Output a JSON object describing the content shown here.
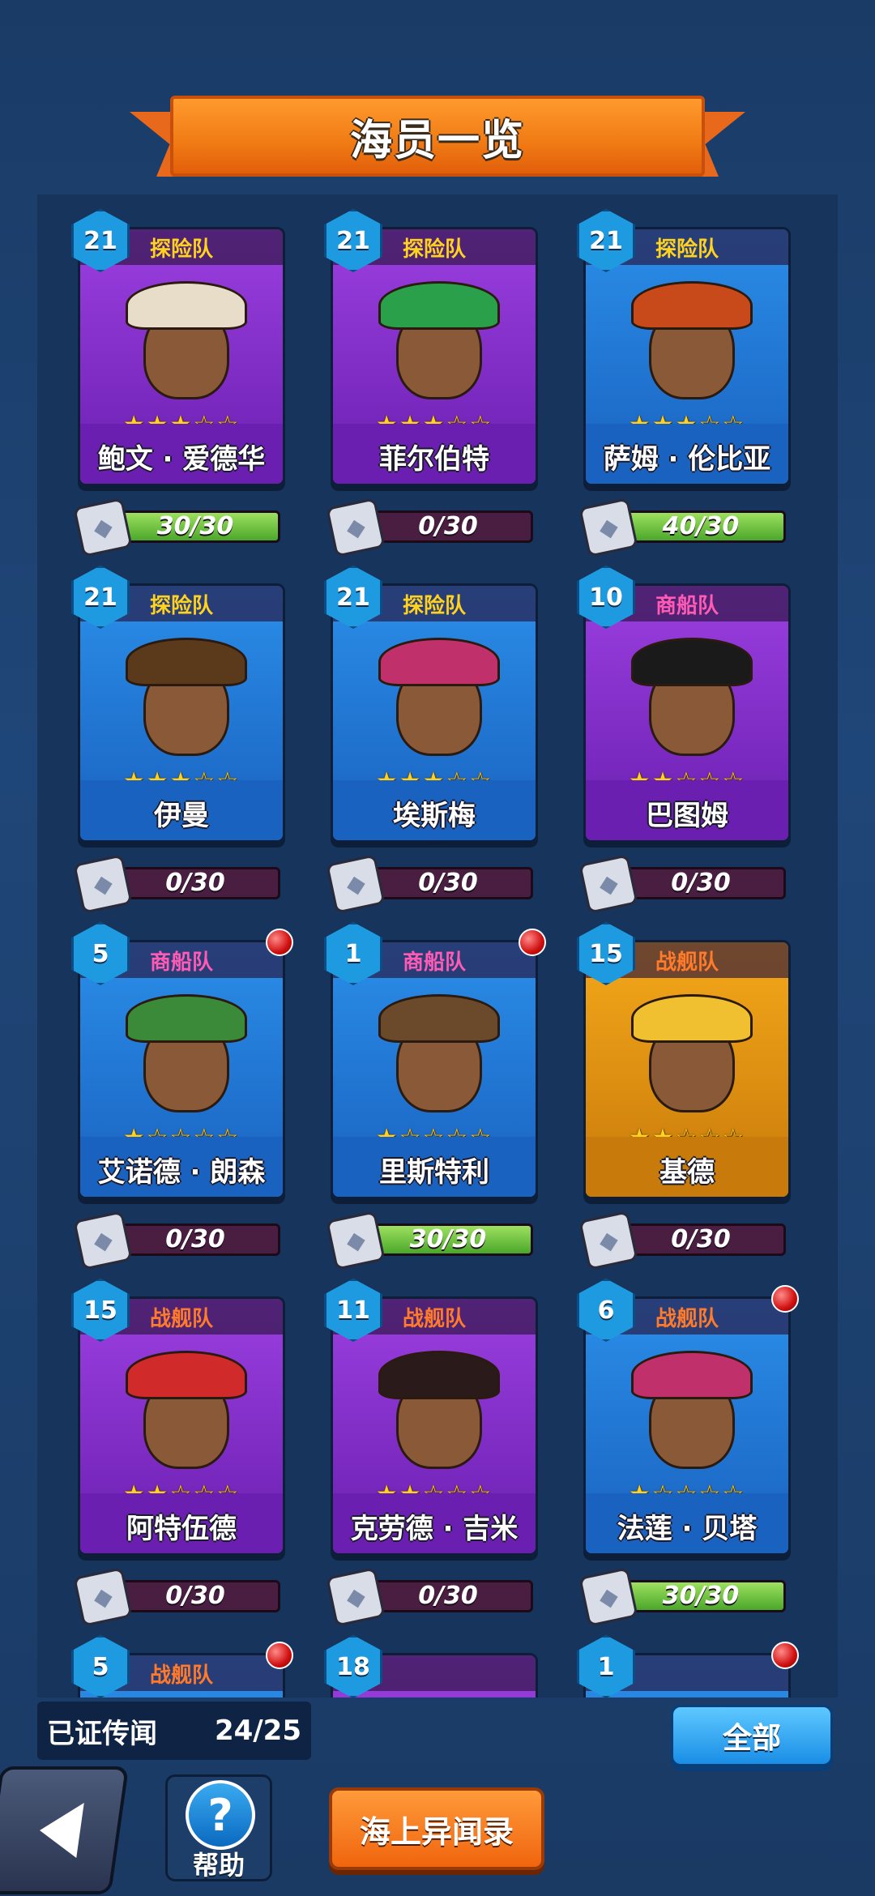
{
  "header": {
    "title": "海员一览"
  },
  "crew": [
    {
      "level": "21",
      "team": "探险队",
      "team_color": "#ffd21f",
      "name": "鲍文 · 爱德华",
      "stars": "★★★☆☆",
      "card_color": "#9b3fe0",
      "frame_color": "#6a1fb0",
      "progress": "30/30",
      "progress_value": 1.0,
      "new_badge": false,
      "hat_color": "#e8ddc8"
    },
    {
      "level": "21",
      "team": "探险队",
      "team_color": "#ffd21f",
      "name": "菲尔伯特",
      "stars": "★★★☆☆",
      "card_color": "#9b3fe0",
      "frame_color": "#6a1fb0",
      "progress": "0/30",
      "progress_value": 0.0,
      "new_badge": false,
      "hat_color": "#2aa04a"
    },
    {
      "level": "21",
      "team": "探险队",
      "team_color": "#ffd21f",
      "name": "萨姆 · 伦比亚",
      "stars": "★★★☆☆",
      "card_color": "#2a8ee8",
      "frame_color": "#1a62c0",
      "progress": "40/30",
      "progress_value": 1.0,
      "new_badge": false,
      "hat_color": "#c84a1a"
    },
    {
      "level": "21",
      "team": "探险队",
      "team_color": "#ffd21f",
      "name": "伊曼",
      "stars": "★★★☆☆",
      "card_color": "#2a8ee8",
      "frame_color": "#1a62c0",
      "progress": "0/30",
      "progress_value": 0.0,
      "new_badge": false,
      "hat_color": "#5a3a1a"
    },
    {
      "level": "21",
      "team": "探险队",
      "team_color": "#ffd21f",
      "name": "埃斯梅",
      "stars": "★★★☆☆",
      "card_color": "#2a8ee8",
      "frame_color": "#1a62c0",
      "progress": "0/30",
      "progress_value": 0.0,
      "new_badge": false,
      "hat_color": "#c0306a"
    },
    {
      "level": "10",
      "team": "商船队",
      "team_color": "#ff5ab4",
      "name": "巴图姆",
      "stars": "★★☆☆☆",
      "card_color": "#9b3fe0",
      "frame_color": "#6a1fb0",
      "progress": "0/30",
      "progress_value": 0.0,
      "new_badge": false,
      "hat_color": "#1a1a1a"
    },
    {
      "level": "5",
      "team": "商船队",
      "team_color": "#ff5ab4",
      "name": "艾诺德 · 朗森",
      "stars": "★☆☆☆☆",
      "card_color": "#2a8ee8",
      "frame_color": "#1a62c0",
      "progress": "0/30",
      "progress_value": 0.0,
      "new_badge": true,
      "hat_color": "#3a8a3a"
    },
    {
      "level": "1",
      "team": "商船队",
      "team_color": "#ff5ab4",
      "name": "里斯特利",
      "stars": "★☆☆☆☆",
      "card_color": "#2a8ee8",
      "frame_color": "#1a62c0",
      "progress": "30/30",
      "progress_value": 1.0,
      "new_badge": true,
      "hat_color": "#6a4a2a"
    },
    {
      "level": "15",
      "team": "战舰队",
      "team_color": "#ff7a2a",
      "name": "基德",
      "stars": "★★☆☆☆",
      "card_color": "#f4a81a",
      "frame_color": "#c87a0a",
      "progress": "0/30",
      "progress_value": 0.0,
      "new_badge": false,
      "hat_color": "#f0c030"
    },
    {
      "level": "15",
      "team": "战舰队",
      "team_color": "#ff7a2a",
      "name": "阿特伍德",
      "stars": "★★☆☆☆",
      "card_color": "#9b3fe0",
      "frame_color": "#6a1fb0",
      "progress": "0/30",
      "progress_value": 0.0,
      "new_badge": false,
      "hat_color": "#d02a2a"
    },
    {
      "level": "11",
      "team": "战舰队",
      "team_color": "#ff7a2a",
      "name": "克劳德 · 吉米",
      "stars": "★★☆☆☆",
      "card_color": "#9b3fe0",
      "frame_color": "#6a1fb0",
      "progress": "0/30",
      "progress_value": 0.0,
      "new_badge": false,
      "hat_color": "#2a1a1a"
    },
    {
      "level": "6",
      "team": "战舰队",
      "team_color": "#ff7a2a",
      "name": "法莲 · 贝塔",
      "stars": "★☆☆☆☆",
      "card_color": "#2a8ee8",
      "frame_color": "#1a62c0",
      "progress": "30/30",
      "progress_value": 1.0,
      "new_badge": true,
      "hat_color": "#c0306a"
    },
    {
      "level": "5",
      "team": "战舰队",
      "team_color": "#ff7a2a",
      "name": "",
      "stars": "",
      "card_color": "#2a8ee8",
      "frame_color": "#1a62c0",
      "progress": "",
      "progress_value": 0.0,
      "new_badge": true,
      "hat_color": "#5a3a1a"
    },
    {
      "level": "18",
      "team": "",
      "team_color": "#ff7a2a",
      "name": "",
      "stars": "",
      "card_color": "#9b3fe0",
      "frame_color": "#6a1fb0",
      "progress": "",
      "progress_value": 0.0,
      "new_badge": false,
      "hat_color": "#d02a2a"
    },
    {
      "level": "1",
      "team": "",
      "team_color": "#ff7a2a",
      "name": "",
      "stars": "",
      "card_color": "#2a8ee8",
      "frame_color": "#1a62c0",
      "progress": "",
      "progress_value": 0.0,
      "new_badge": true,
      "hat_color": "#2a8ee8"
    }
  ],
  "footer": {
    "proven_label": "已证传闻",
    "proven_count": "24/25",
    "all_button": "全部",
    "help_label": "帮助",
    "help_icon": "?",
    "tales_button": "海上异闻录"
  },
  "icons": {
    "back": "back-arrow-icon",
    "help": "question-mark-icon",
    "shard": "puzzle-shard-icon"
  }
}
